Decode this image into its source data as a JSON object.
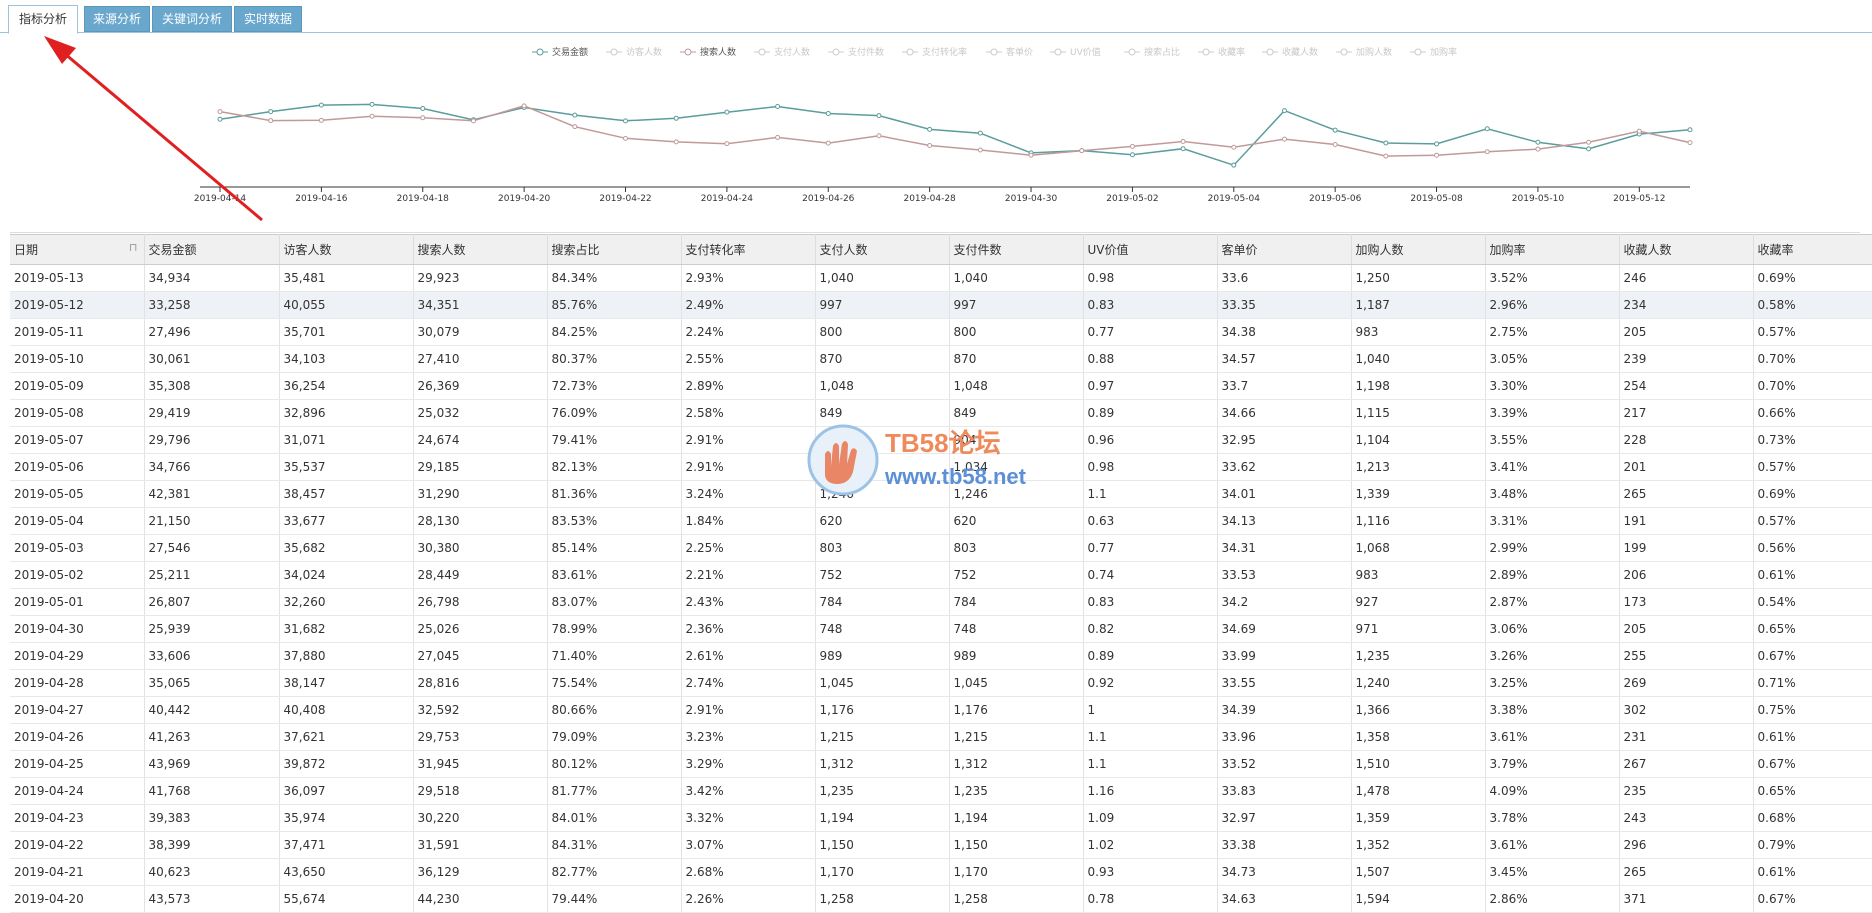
{
  "tabs": [
    {
      "label": "指标分析",
      "active": true
    },
    {
      "label": "来源分析",
      "active": false
    },
    {
      "label": "关键词分析",
      "active": false
    },
    {
      "label": "实时数据",
      "active": false
    }
  ],
  "watermark": {
    "brand": "TB58论坛",
    "url": "www.tb58.net"
  },
  "chart_data": {
    "type": "line",
    "legend": [
      "交易金额",
      "访客人数",
      "搜索人数",
      "支付人数",
      "支付件数",
      "支付转化率",
      "客单价",
      "UV价值",
      "搜索占比",
      "收藏率",
      "收藏人数",
      "加购人数",
      "加购率"
    ],
    "legend_active": [
      "交易金额",
      "搜索人数"
    ],
    "x": [
      "2019-04-14",
      "2019-04-15",
      "2019-04-16",
      "2019-04-17",
      "2019-04-18",
      "2019-04-19",
      "2019-04-20",
      "2019-04-21",
      "2019-04-22",
      "2019-04-23",
      "2019-04-24",
      "2019-04-25",
      "2019-04-26",
      "2019-04-27",
      "2019-04-28",
      "2019-04-29",
      "2019-04-30",
      "2019-05-01",
      "2019-05-02",
      "2019-05-03",
      "2019-05-04",
      "2019-05-05",
      "2019-05-06",
      "2019-05-07",
      "2019-05-08",
      "2019-05-09",
      "2019-05-10",
      "2019-05-11",
      "2019-05-12",
      "2019-05-13"
    ],
    "x_tick_labels": [
      "2019-04-14",
      "2019-04-16",
      "2019-04-18",
      "2019-04-20",
      "2019-04-22",
      "2019-04-24",
      "2019-04-26",
      "2019-04-28",
      "2019-04-30",
      "2019-05-02",
      "2019-05-04",
      "2019-05-06",
      "2019-05-08",
      "2019-05-10",
      "2019-05-12"
    ],
    "series": [
      {
        "name": "交易金额",
        "color": "#5b9c9c",
        "values": [
          39000,
          42000,
          44500,
          44800,
          43200,
          38800,
          43573,
          40623,
          38399,
          39383,
          41768,
          43969,
          41263,
          40442,
          35065,
          33606,
          25939,
          26807,
          25211,
          27546,
          21150,
          42381,
          34766,
          29796,
          29419,
          35308,
          30061,
          27496,
          33258,
          34934
        ]
      },
      {
        "name": "搜索人数",
        "color": "#c09a9a",
        "values": [
          42000,
          38500,
          38600,
          40200,
          39600,
          38400,
          44230,
          36129,
          31591,
          30220,
          29518,
          31945,
          29753,
          32592,
          28816,
          27045,
          25026,
          26798,
          28449,
          30380,
          28130,
          31290,
          29185,
          24674,
          25032,
          26369,
          27410,
          30079,
          34351,
          29923
        ]
      }
    ]
  },
  "table": {
    "columns": [
      "日期",
      "交易金额",
      "访客人数",
      "搜索人数",
      "搜索占比",
      "支付转化率",
      "支付人数",
      "支付件数",
      "UV价值",
      "客单价",
      "加购人数",
      "加购率",
      "收藏人数",
      "收藏率"
    ],
    "selected_row": 1,
    "rows": [
      [
        "2019-05-13",
        "34,934",
        "35,481",
        "29,923",
        "84.34%",
        "2.93%",
        "1,040",
        "1,040",
        "0.98",
        "33.6",
        "1,250",
        "3.52%",
        "246",
        "0.69%"
      ],
      [
        "2019-05-12",
        "33,258",
        "40,055",
        "34,351",
        "85.76%",
        "2.49%",
        "997",
        "997",
        "0.83",
        "33.35",
        "1,187",
        "2.96%",
        "234",
        "0.58%"
      ],
      [
        "2019-05-11",
        "27,496",
        "35,701",
        "30,079",
        "84.25%",
        "2.24%",
        "800",
        "800",
        "0.77",
        "34.38",
        "983",
        "2.75%",
        "205",
        "0.57%"
      ],
      [
        "2019-05-10",
        "30,061",
        "34,103",
        "27,410",
        "80.37%",
        "2.55%",
        "870",
        "870",
        "0.88",
        "34.57",
        "1,040",
        "3.05%",
        "239",
        "0.70%"
      ],
      [
        "2019-05-09",
        "35,308",
        "36,254",
        "26,369",
        "72.73%",
        "2.89%",
        "1,048",
        "1,048",
        "0.97",
        "33.7",
        "1,198",
        "3.30%",
        "254",
        "0.70%"
      ],
      [
        "2019-05-08",
        "29,419",
        "32,896",
        "25,032",
        "76.09%",
        "2.58%",
        "849",
        "849",
        "0.89",
        "34.66",
        "1,115",
        "3.39%",
        "217",
        "0.66%"
      ],
      [
        "2019-05-07",
        "29,796",
        "31,071",
        "24,674",
        "79.41%",
        "2.91%",
        "904",
        "904",
        "0.96",
        "32.95",
        "1,104",
        "3.55%",
        "228",
        "0.73%"
      ],
      [
        "2019-05-06",
        "34,766",
        "35,537",
        "29,185",
        "82.13%",
        "2.91%",
        "1,034",
        "1,034",
        "0.98",
        "33.62",
        "1,213",
        "3.41%",
        "201",
        "0.57%"
      ],
      [
        "2019-05-05",
        "42,381",
        "38,457",
        "31,290",
        "81.36%",
        "3.24%",
        "1,246",
        "1,246",
        "1.1",
        "34.01",
        "1,339",
        "3.48%",
        "265",
        "0.69%"
      ],
      [
        "2019-05-04",
        "21,150",
        "33,677",
        "28,130",
        "83.53%",
        "1.84%",
        "620",
        "620",
        "0.63",
        "34.13",
        "1,116",
        "3.31%",
        "191",
        "0.57%"
      ],
      [
        "2019-05-03",
        "27,546",
        "35,682",
        "30,380",
        "85.14%",
        "2.25%",
        "803",
        "803",
        "0.77",
        "34.31",
        "1,068",
        "2.99%",
        "199",
        "0.56%"
      ],
      [
        "2019-05-02",
        "25,211",
        "34,024",
        "28,449",
        "83.61%",
        "2.21%",
        "752",
        "752",
        "0.74",
        "33.53",
        "983",
        "2.89%",
        "206",
        "0.61%"
      ],
      [
        "2019-05-01",
        "26,807",
        "32,260",
        "26,798",
        "83.07%",
        "2.43%",
        "784",
        "784",
        "0.83",
        "34.2",
        "927",
        "2.87%",
        "173",
        "0.54%"
      ],
      [
        "2019-04-30",
        "25,939",
        "31,682",
        "25,026",
        "78.99%",
        "2.36%",
        "748",
        "748",
        "0.82",
        "34.69",
        "971",
        "3.06%",
        "205",
        "0.65%"
      ],
      [
        "2019-04-29",
        "33,606",
        "37,880",
        "27,045",
        "71.40%",
        "2.61%",
        "989",
        "989",
        "0.89",
        "33.99",
        "1,235",
        "3.26%",
        "255",
        "0.67%"
      ],
      [
        "2019-04-28",
        "35,065",
        "38,147",
        "28,816",
        "75.54%",
        "2.74%",
        "1,045",
        "1,045",
        "0.92",
        "33.55",
        "1,240",
        "3.25%",
        "269",
        "0.71%"
      ],
      [
        "2019-04-27",
        "40,442",
        "40,408",
        "32,592",
        "80.66%",
        "2.91%",
        "1,176",
        "1,176",
        "1",
        "34.39",
        "1,366",
        "3.38%",
        "302",
        "0.75%"
      ],
      [
        "2019-04-26",
        "41,263",
        "37,621",
        "29,753",
        "79.09%",
        "3.23%",
        "1,215",
        "1,215",
        "1.1",
        "33.96",
        "1,358",
        "3.61%",
        "231",
        "0.61%"
      ],
      [
        "2019-04-25",
        "43,969",
        "39,872",
        "31,945",
        "80.12%",
        "3.29%",
        "1,312",
        "1,312",
        "1.1",
        "33.52",
        "1,510",
        "3.79%",
        "267",
        "0.67%"
      ],
      [
        "2019-04-24",
        "41,768",
        "36,097",
        "29,518",
        "81.77%",
        "3.42%",
        "1,235",
        "1,235",
        "1.16",
        "33.83",
        "1,478",
        "4.09%",
        "235",
        "0.65%"
      ],
      [
        "2019-04-23",
        "39,383",
        "35,974",
        "30,220",
        "84.01%",
        "3.32%",
        "1,194",
        "1,194",
        "1.09",
        "32.97",
        "1,359",
        "3.78%",
        "243",
        "0.68%"
      ],
      [
        "2019-04-22",
        "38,399",
        "37,471",
        "31,591",
        "84.31%",
        "3.07%",
        "1,150",
        "1,150",
        "1.02",
        "33.38",
        "1,352",
        "3.61%",
        "296",
        "0.79%"
      ],
      [
        "2019-04-21",
        "40,623",
        "43,650",
        "36,129",
        "82.77%",
        "2.68%",
        "1,170",
        "1,170",
        "0.93",
        "34.73",
        "1,507",
        "3.45%",
        "265",
        "0.61%"
      ],
      [
        "2019-04-20",
        "43,573",
        "55,674",
        "44,230",
        "79.44%",
        "2.26%",
        "1,258",
        "1,258",
        "0.78",
        "34.63",
        "1,594",
        "2.86%",
        "371",
        "0.67%"
      ]
    ]
  }
}
